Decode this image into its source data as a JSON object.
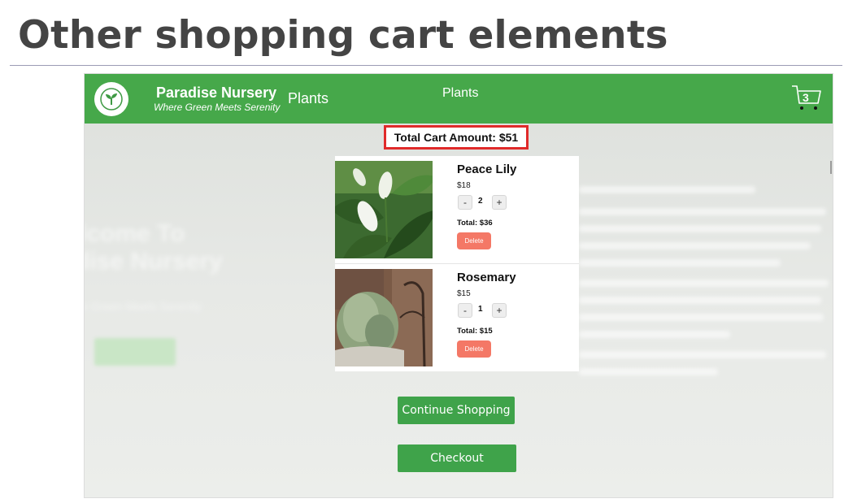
{
  "slide": {
    "title": "Other shopping cart elements"
  },
  "navbar": {
    "brand_name": "Paradise Nursery",
    "tagline": "Where Green Meets Serenity",
    "link_1": "Plants",
    "link_2": "Plants",
    "cart_count": "3",
    "icons": [
      "seedling-logo-icon",
      "cart-icon"
    ],
    "color": "#46a84a"
  },
  "cart": {
    "total_label": "Total Cart Amount: $51",
    "items": [
      {
        "name": "Peace Lily",
        "price": "$18",
        "minus": "-",
        "quantity": "2",
        "plus": "+",
        "total": "Total: $36",
        "delete": "Delete"
      },
      {
        "name": "Rosemary",
        "price": "$15",
        "minus": "-",
        "quantity": "1",
        "plus": "+",
        "total": "Total: $15",
        "delete": "Delete"
      }
    ],
    "continue_label": "Continue Shopping",
    "checkout_label": "Checkout"
  },
  "colors": {
    "accent_green": "#3fa34a",
    "delete_red": "#f47866",
    "highlight_border": "#e02a2a"
  }
}
